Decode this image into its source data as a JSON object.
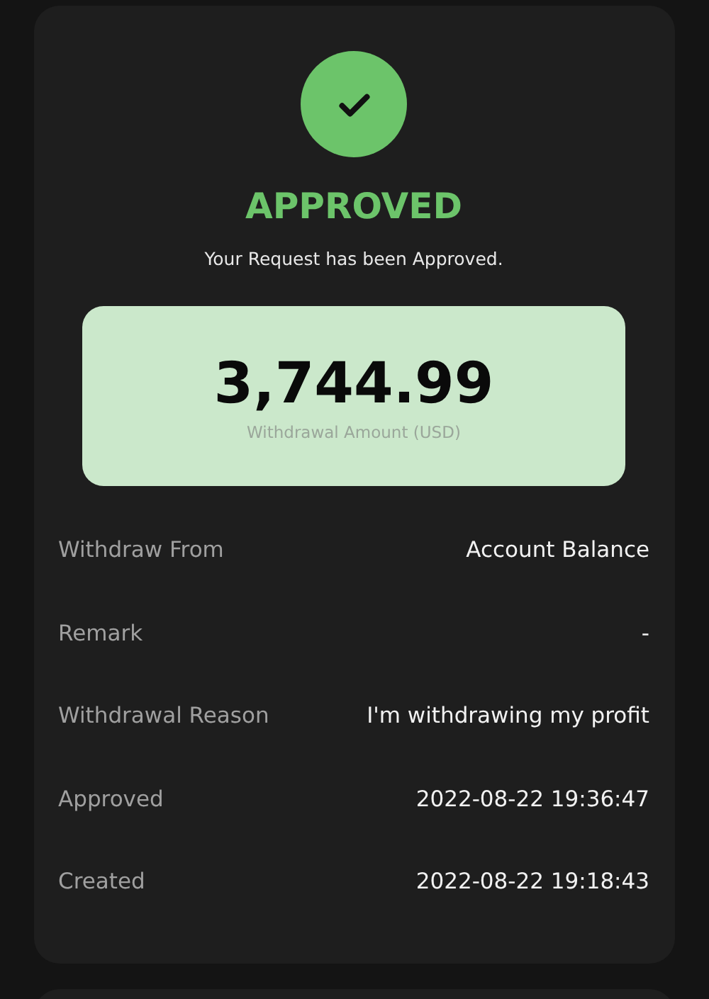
{
  "status": {
    "kind": "approved",
    "title": "APPROVED",
    "message": "Your Request has been Approved."
  },
  "amount": {
    "value": "3,744.99",
    "label": "Withdrawal Amount (USD)"
  },
  "details": [
    {
      "label": "Withdraw From",
      "value": "Account Balance"
    },
    {
      "label": "Remark",
      "value": "-"
    },
    {
      "label": "Withdrawal Reason",
      "value": "I'm withdrawing my profit"
    },
    {
      "label": "Approved",
      "value": "2022-08-22 19:36:47"
    },
    {
      "label": "Created",
      "value": "2022-08-22 19:18:43"
    }
  ]
}
